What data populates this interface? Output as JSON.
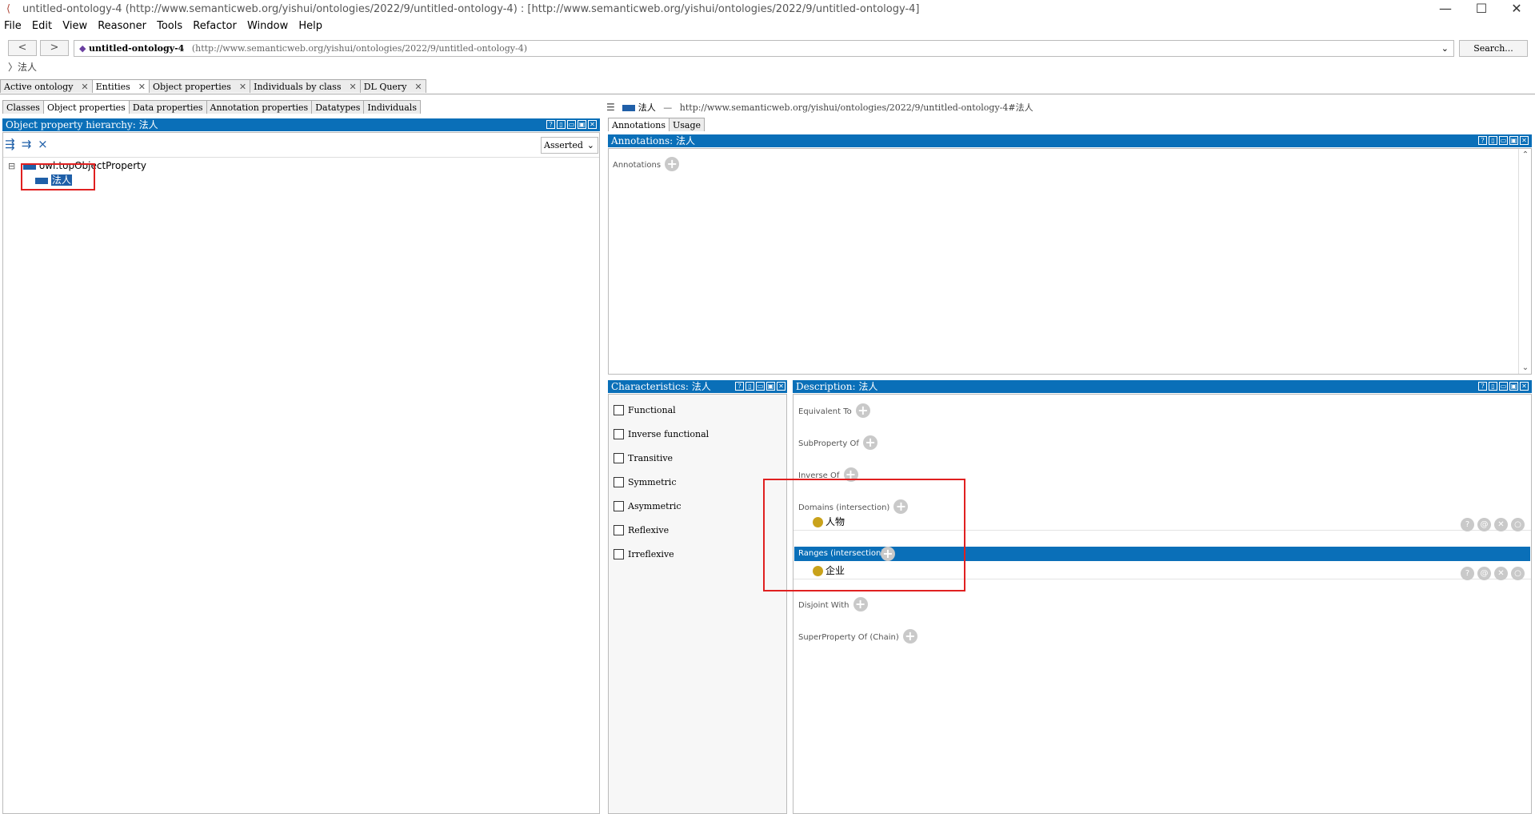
{
  "window": {
    "title": "untitled-ontology-4 (http://www.semanticweb.org/yishui/ontologies/2022/9/untitled-ontology-4) : [http://www.semanticweb.org/yishui/ontologies/2022/9/untitled-ontology-4]",
    "minimize": "—",
    "maximize": "☐",
    "close": "✕"
  },
  "menu": [
    "File",
    "Edit",
    "View",
    "Reasoner",
    "Tools",
    "Refactor",
    "Window",
    "Help"
  ],
  "nav": {
    "back": "<",
    "forward": ">",
    "ontology_name": "untitled-ontology-4",
    "ontology_uri": "(http://www.semanticweb.org/yishui/ontologies/2022/9/untitled-ontology-4)",
    "search_label": "Search..."
  },
  "breadcrumb": "〉法人",
  "main_tabs": [
    {
      "label": "Active ontology",
      "close": "✕"
    },
    {
      "label": "Entities",
      "close": "✕"
    },
    {
      "label": "Object properties",
      "close": "✕"
    },
    {
      "label": "Individuals by class",
      "close": "✕"
    },
    {
      "label": "DL Query",
      "close": "✕"
    }
  ],
  "entity_tabs": [
    "Classes",
    "Object properties",
    "Data properties",
    "Annotation properties",
    "Datatypes",
    "Individuals"
  ],
  "hierarchy": {
    "header": "Object property hierarchy: 法人",
    "mode": "Asserted",
    "root": "owl:topObjectProperty",
    "child": "法人",
    "expander": "⊟"
  },
  "entity": {
    "name": "法人",
    "separator": "—",
    "uri": "http://www.semanticweb.org/yishui/ontologies/2022/9/untitled-ontology-4#法人"
  },
  "right_tabs": [
    "Annotations",
    "Usage"
  ],
  "annotations": {
    "header": "Annotations: 法人",
    "label": "Annotations"
  },
  "characteristics": {
    "header": "Characteristics: 法人",
    "items": [
      "Functional",
      "Inverse functional",
      "Transitive",
      "Symmetric",
      "Asymmetric",
      "Reflexive",
      "Irreflexive"
    ]
  },
  "description": {
    "header": "Description: 法人",
    "equivalent_to": "Equivalent To",
    "subproperty_of": "SubProperty Of",
    "inverse_of": "Inverse Of",
    "domains": "Domains (intersection)",
    "domain_value": "人物",
    "ranges": "Ranges (intersection)",
    "range_value": "企业",
    "disjoint_with": "Disjoint With",
    "superproperty_chain": "SuperProperty Of (Chain)"
  },
  "row_buttons": [
    "?",
    "@",
    "✕",
    "○"
  ],
  "panel_controls": [
    "?",
    "▯",
    "▭",
    "▣",
    "✕"
  ],
  "toolbar_icons": [
    "add-subproperty-icon",
    "add-sibling-property-icon",
    "delete-property-icon"
  ],
  "colors": {
    "header_blue": "#0a6fb8",
    "highlight_red": "#e02020",
    "class_dot": "#c9a21b"
  }
}
